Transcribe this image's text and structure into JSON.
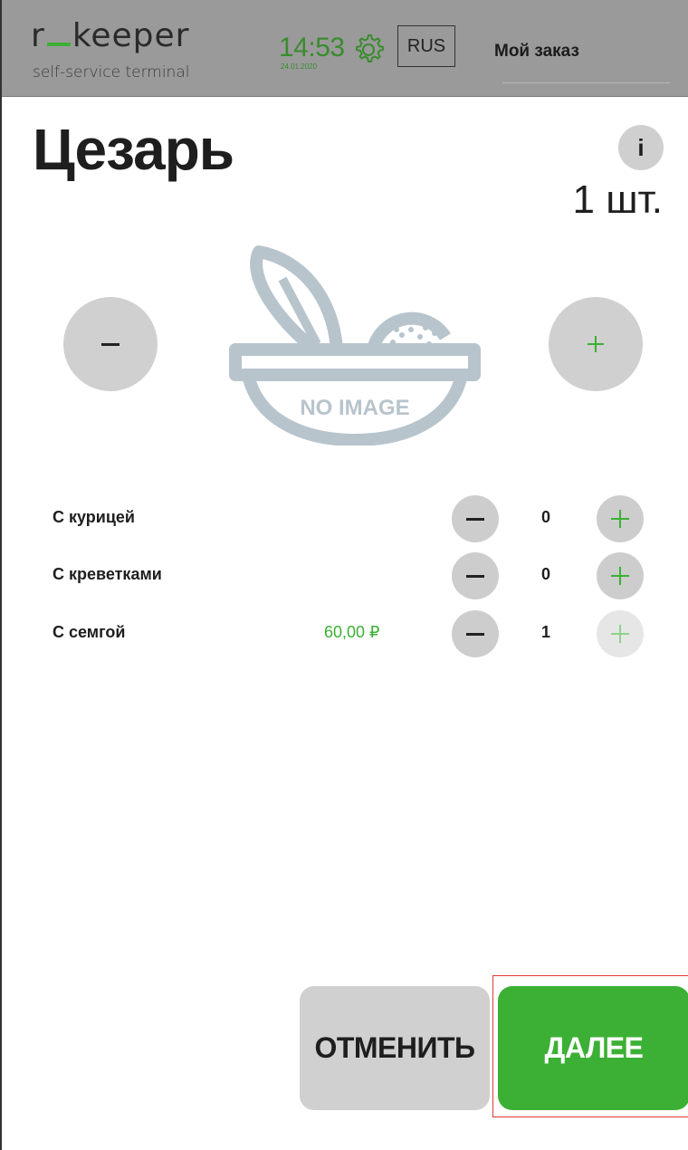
{
  "header": {
    "logo": "r_keeper",
    "logo_sub": "self-service terminal",
    "time": "14:53",
    "date": "24.01.2020",
    "language": "RUS",
    "my_order": "Мой заказ"
  },
  "product": {
    "title": "Цезарь",
    "info": "i",
    "quantity_label": "1 шт.",
    "no_image_text": "NO IMAGE"
  },
  "modifiers": [
    {
      "name": "С курицей",
      "price": "",
      "count": "0"
    },
    {
      "name": "С креветками",
      "price": "",
      "count": "0"
    },
    {
      "name": "С семгой",
      "price": "60,00 ₽",
      "count": "1"
    }
  ],
  "footer": {
    "cancel_label": "ОТМЕНИТЬ",
    "next_label": "ДАЛЕЕ"
  },
  "colors": {
    "accent_green": "#3cb034",
    "header_bg": "#9a9a9a",
    "button_gray": "#d0d0d0",
    "highlight_red": "#e03a3a"
  },
  "icons": {
    "settings": "gear-icon",
    "minus": "minus-icon",
    "plus": "plus-icon",
    "placeholder": "no-image-salad-icon"
  }
}
